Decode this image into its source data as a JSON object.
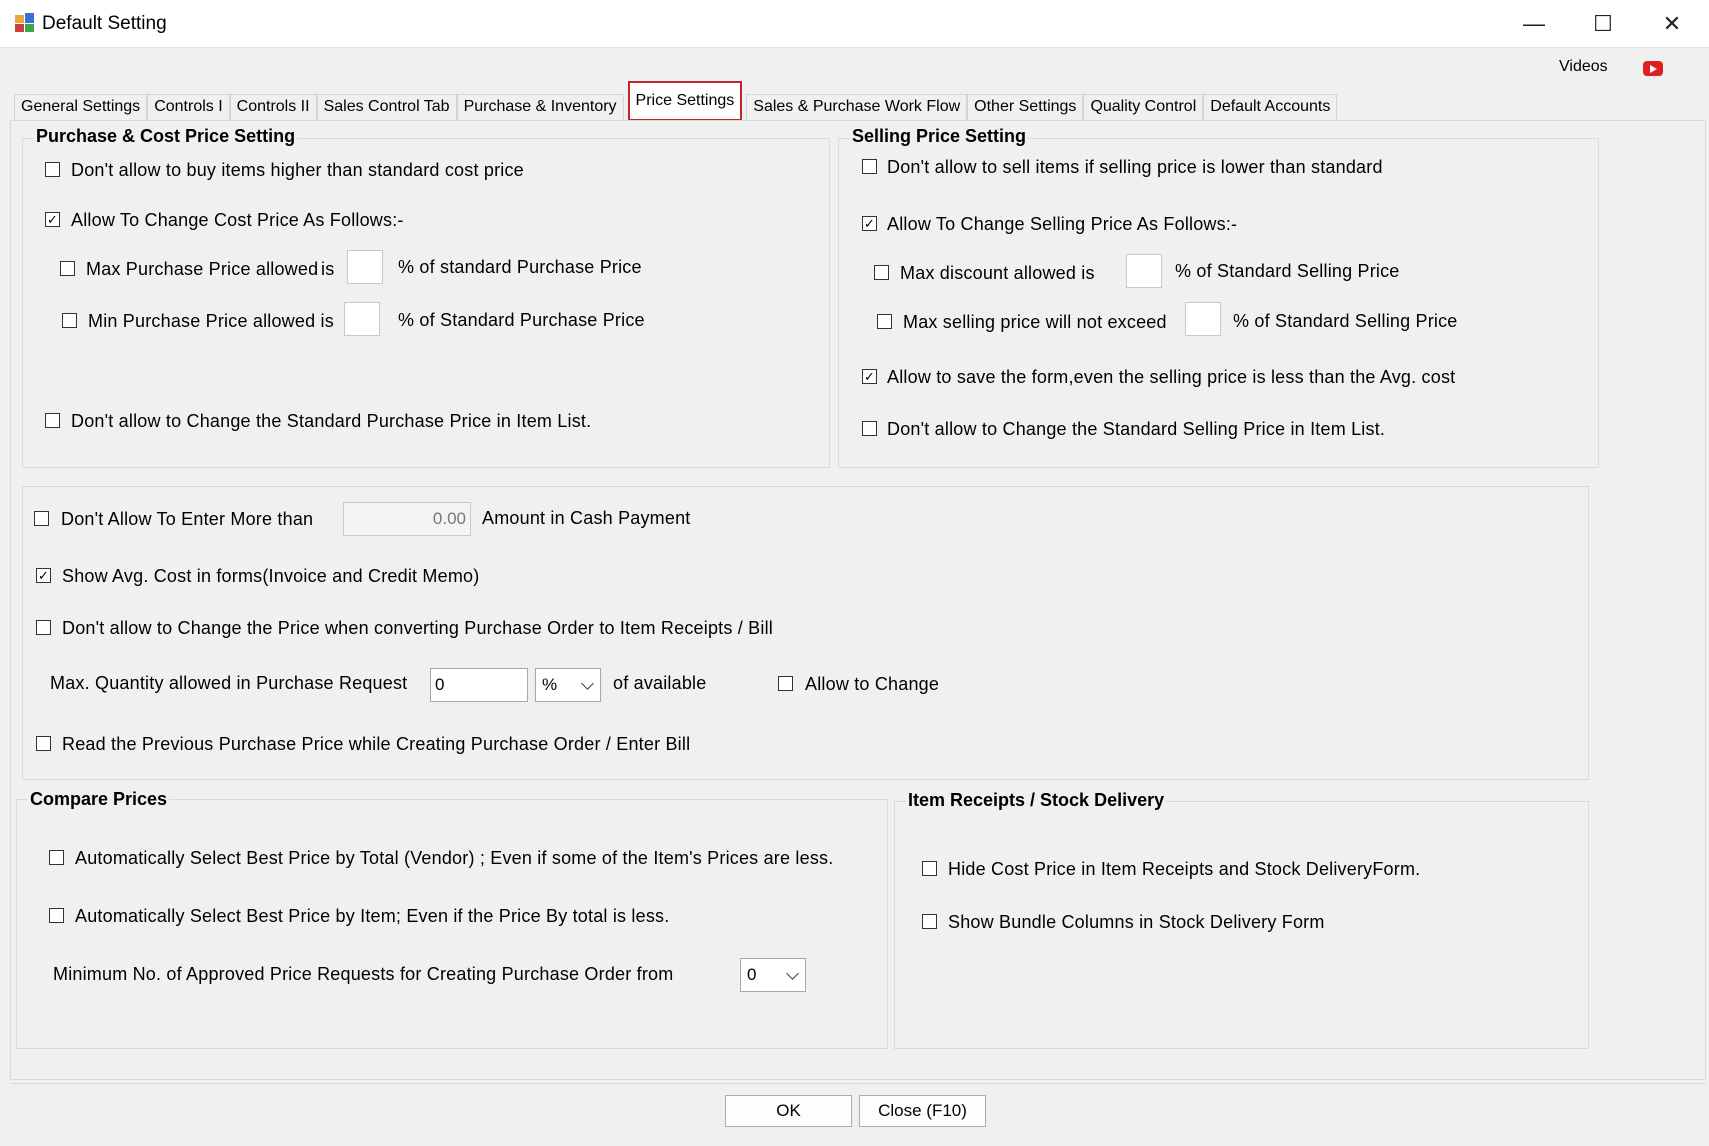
{
  "window": {
    "title": "Default Setting",
    "minimize": "—",
    "maximize": "☐",
    "close": "✕"
  },
  "videos_label": "Videos",
  "tabs": [
    "General Settings",
    "Controls I",
    "Controls II",
    "Sales Control Tab",
    "Purchase & Inventory",
    "Price Settings",
    "Sales & Purchase Work Flow",
    "Other Settings",
    "Quality Control",
    "Default Accounts"
  ],
  "active_tab": "Price Settings",
  "purchase": {
    "title": "Purchase & Cost Price Setting",
    "no_buy_higher": "Don't allow to buy items higher than standard cost price",
    "allow_change": "Allow To Change Cost Price As Follows:-",
    "max_prefix": "Max Purchase Price allowed",
    "max_is": "is",
    "max_suffix": "% of standard Purchase Price",
    "min_prefix": "Min Purchase Price allowed is",
    "min_suffix": "% of Standard Purchase Price",
    "no_change_std": "Don't allow to Change the Standard Purchase Price in Item List."
  },
  "selling": {
    "title": "Selling Price Setting",
    "no_sell_lower": "Don't allow to sell items if selling price is lower than standard",
    "allow_change": "Allow To Change Selling Price As Follows:-",
    "max_discount": "Max discount allowed is",
    "max_discount_suffix": "% of Standard Selling Price",
    "max_selling": "Max selling price will not exceed",
    "max_selling_suffix": "% of Standard Selling Price",
    "allow_save": "Allow to save the form,even the selling price is less than the Avg. cost",
    "no_change_std": "Don't allow to Change the Standard Selling Price in Item List."
  },
  "middle": {
    "cash_prefix": "Don't Allow To Enter More than",
    "cash_value": "0.00",
    "cash_suffix": "Amount in Cash Payment",
    "show_avg": "Show Avg. Cost in forms(Invoice and Credit Memo)",
    "no_change_po": "Don't allow to Change the Price when converting Purchase Order to Item Receipts / Bill",
    "max_qty_label": "Max. Quantity allowed in Purchase Request",
    "max_qty_value": "0",
    "max_qty_unit": "%",
    "of_available": "of available",
    "allow_to_change": "Allow to Change",
    "read_prev": "Read the Previous Purchase Price while Creating Purchase Order / Enter Bill"
  },
  "compare": {
    "title": "Compare Prices",
    "best_total": "Automatically Select Best Price by Total (Vendor) ; Even if some of the Item's Prices are less.",
    "best_item": "Automatically Select Best Price by Item; Even if the Price By total is less.",
    "min_requests": "Minimum No. of Approved Price Requests for Creating Purchase Order from",
    "min_requests_value": "0"
  },
  "receipts": {
    "title": "Item Receipts / Stock Delivery",
    "hide_cost": "Hide Cost Price in Item Receipts and Stock DeliveryForm.",
    "show_bundle": "Show Bundle Columns in Stock Delivery Form"
  },
  "buttons": {
    "ok": "OK",
    "close": "Close (F10)"
  },
  "checked_mark": "✓",
  "colors": {
    "active_tab_border": "#c0262c",
    "youtube": "#e02020"
  }
}
